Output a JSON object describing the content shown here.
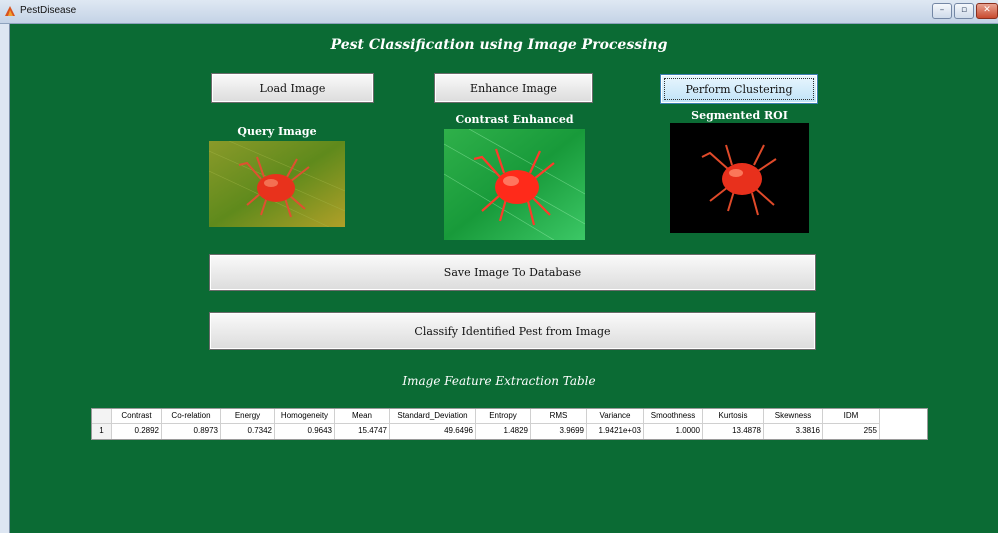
{
  "window": {
    "title": "PestDisease"
  },
  "page_title": "Pest Classification using Image Processing",
  "buttons": {
    "load": "Load Image",
    "enhance": "Enhance Image",
    "cluster": "Perform Clustering",
    "save": "Save Image To Database",
    "classify": "Classify Identified Pest from Image"
  },
  "images": {
    "query": "Query Image",
    "contrast": "Contrast Enhanced",
    "segmented": "Segmented ROI"
  },
  "table": {
    "caption": "Image Feature Extraction Table",
    "columns": [
      "Contrast",
      "Co-relation",
      "Energy",
      "Homogeneity",
      "Mean",
      "Standard_Deviation",
      "Entropy",
      "RMS",
      "Variance",
      "Smoothness",
      "Kurtosis",
      "Skewness",
      "IDM"
    ],
    "rows": [
      {
        "label": "1",
        "values": [
          "0.2892",
          "0.8973",
          "0.7342",
          "0.9643",
          "15.4747",
          "49.6496",
          "1.4829",
          "3.9699",
          "1.9421e+03",
          "1.0000",
          "13.4878",
          "3.3816",
          "255"
        ]
      }
    ]
  }
}
